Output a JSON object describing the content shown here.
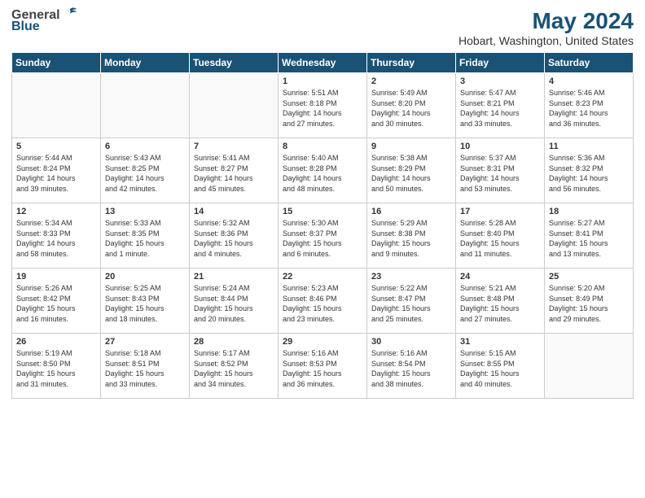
{
  "header": {
    "logo_general": "General",
    "logo_blue": "Blue",
    "title": "May 2024",
    "subtitle": "Hobart, Washington, United States"
  },
  "weekdays": [
    "Sunday",
    "Monday",
    "Tuesday",
    "Wednesday",
    "Thursday",
    "Friday",
    "Saturday"
  ],
  "weeks": [
    [
      {
        "date": "",
        "info": ""
      },
      {
        "date": "",
        "info": ""
      },
      {
        "date": "",
        "info": ""
      },
      {
        "date": "1",
        "info": "Sunrise: 5:51 AM\nSunset: 8:18 PM\nDaylight: 14 hours\nand 27 minutes."
      },
      {
        "date": "2",
        "info": "Sunrise: 5:49 AM\nSunset: 8:20 PM\nDaylight: 14 hours\nand 30 minutes."
      },
      {
        "date": "3",
        "info": "Sunrise: 5:47 AM\nSunset: 8:21 PM\nDaylight: 14 hours\nand 33 minutes."
      },
      {
        "date": "4",
        "info": "Sunrise: 5:46 AM\nSunset: 8:23 PM\nDaylight: 14 hours\nand 36 minutes."
      }
    ],
    [
      {
        "date": "5",
        "info": "Sunrise: 5:44 AM\nSunset: 8:24 PM\nDaylight: 14 hours\nand 39 minutes."
      },
      {
        "date": "6",
        "info": "Sunrise: 5:43 AM\nSunset: 8:25 PM\nDaylight: 14 hours\nand 42 minutes."
      },
      {
        "date": "7",
        "info": "Sunrise: 5:41 AM\nSunset: 8:27 PM\nDaylight: 14 hours\nand 45 minutes."
      },
      {
        "date": "8",
        "info": "Sunrise: 5:40 AM\nSunset: 8:28 PM\nDaylight: 14 hours\nand 48 minutes."
      },
      {
        "date": "9",
        "info": "Sunrise: 5:38 AM\nSunset: 8:29 PM\nDaylight: 14 hours\nand 50 minutes."
      },
      {
        "date": "10",
        "info": "Sunrise: 5:37 AM\nSunset: 8:31 PM\nDaylight: 14 hours\nand 53 minutes."
      },
      {
        "date": "11",
        "info": "Sunrise: 5:36 AM\nSunset: 8:32 PM\nDaylight: 14 hours\nand 56 minutes."
      }
    ],
    [
      {
        "date": "12",
        "info": "Sunrise: 5:34 AM\nSunset: 8:33 PM\nDaylight: 14 hours\nand 58 minutes."
      },
      {
        "date": "13",
        "info": "Sunrise: 5:33 AM\nSunset: 8:35 PM\nDaylight: 15 hours\nand 1 minute."
      },
      {
        "date": "14",
        "info": "Sunrise: 5:32 AM\nSunset: 8:36 PM\nDaylight: 15 hours\nand 4 minutes."
      },
      {
        "date": "15",
        "info": "Sunrise: 5:30 AM\nSunset: 8:37 PM\nDaylight: 15 hours\nand 6 minutes."
      },
      {
        "date": "16",
        "info": "Sunrise: 5:29 AM\nSunset: 8:38 PM\nDaylight: 15 hours\nand 9 minutes."
      },
      {
        "date": "17",
        "info": "Sunrise: 5:28 AM\nSunset: 8:40 PM\nDaylight: 15 hours\nand 11 minutes."
      },
      {
        "date": "18",
        "info": "Sunrise: 5:27 AM\nSunset: 8:41 PM\nDaylight: 15 hours\nand 13 minutes."
      }
    ],
    [
      {
        "date": "19",
        "info": "Sunrise: 5:26 AM\nSunset: 8:42 PM\nDaylight: 15 hours\nand 16 minutes."
      },
      {
        "date": "20",
        "info": "Sunrise: 5:25 AM\nSunset: 8:43 PM\nDaylight: 15 hours\nand 18 minutes."
      },
      {
        "date": "21",
        "info": "Sunrise: 5:24 AM\nSunset: 8:44 PM\nDaylight: 15 hours\nand 20 minutes."
      },
      {
        "date": "22",
        "info": "Sunrise: 5:23 AM\nSunset: 8:46 PM\nDaylight: 15 hours\nand 23 minutes."
      },
      {
        "date": "23",
        "info": "Sunrise: 5:22 AM\nSunset: 8:47 PM\nDaylight: 15 hours\nand 25 minutes."
      },
      {
        "date": "24",
        "info": "Sunrise: 5:21 AM\nSunset: 8:48 PM\nDaylight: 15 hours\nand 27 minutes."
      },
      {
        "date": "25",
        "info": "Sunrise: 5:20 AM\nSunset: 8:49 PM\nDaylight: 15 hours\nand 29 minutes."
      }
    ],
    [
      {
        "date": "26",
        "info": "Sunrise: 5:19 AM\nSunset: 8:50 PM\nDaylight: 15 hours\nand 31 minutes."
      },
      {
        "date": "27",
        "info": "Sunrise: 5:18 AM\nSunset: 8:51 PM\nDaylight: 15 hours\nand 33 minutes."
      },
      {
        "date": "28",
        "info": "Sunrise: 5:17 AM\nSunset: 8:52 PM\nDaylight: 15 hours\nand 34 minutes."
      },
      {
        "date": "29",
        "info": "Sunrise: 5:16 AM\nSunset: 8:53 PM\nDaylight: 15 hours\nand 36 minutes."
      },
      {
        "date": "30",
        "info": "Sunrise: 5:16 AM\nSunset: 8:54 PM\nDaylight: 15 hours\nand 38 minutes."
      },
      {
        "date": "31",
        "info": "Sunrise: 5:15 AM\nSunset: 8:55 PM\nDaylight: 15 hours\nand 40 minutes."
      },
      {
        "date": "",
        "info": ""
      }
    ]
  ]
}
